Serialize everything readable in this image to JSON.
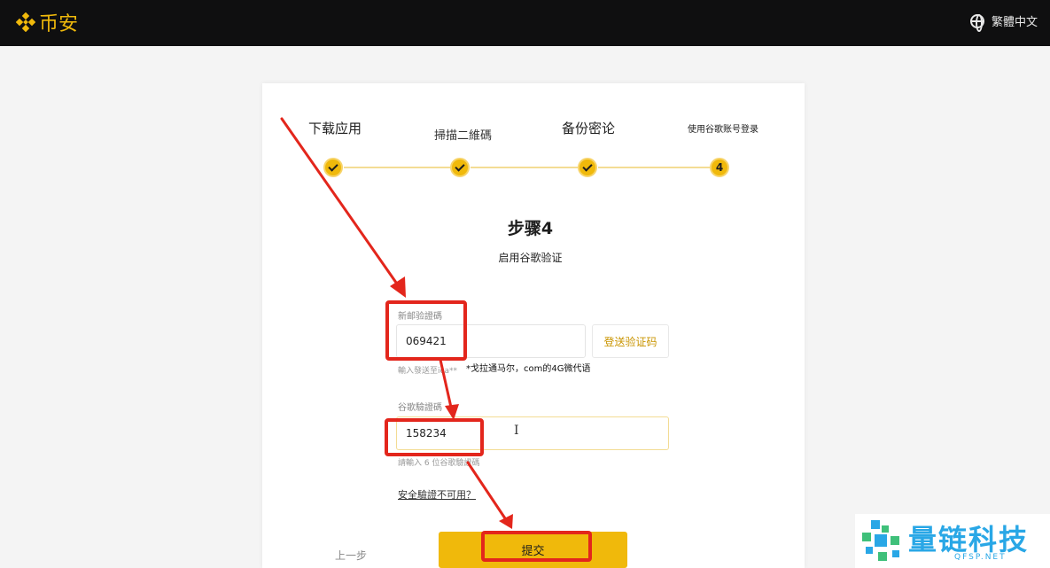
{
  "header": {
    "logo_text": "币安",
    "language": "繁體中文",
    "accent_color": "#f0b90b"
  },
  "stepper": {
    "steps": [
      {
        "label": "下载应用",
        "state": "done"
      },
      {
        "label": "掃描二維碼",
        "state": "done"
      },
      {
        "label": "备份密论",
        "state": "done"
      },
      {
        "label": "使用谷歌账号登录",
        "state": "current",
        "number": "4"
      }
    ]
  },
  "main": {
    "title": "步骤4",
    "subtitle": "启用谷歌验证"
  },
  "form": {
    "new_code_label": "新邮验證碼",
    "new_code_value": "069421",
    "send_code_label": "登送验证码",
    "new_code_hint": "輸入發送至ica**",
    "note_text": "*戈拉通马尔，com的4G微代语",
    "google_code_label": "谷歌驗證碼",
    "google_code_value": "158234",
    "google_code_hint": "請輸入 6 位谷歌驗證碼",
    "security_link": "安全驗證不可用？",
    "prev_label": "上一步",
    "submit_label": "提交"
  },
  "watermark": {
    "text": "量链科技",
    "sub": "QFSP.NET"
  },
  "annotation_color": "#e3261c"
}
